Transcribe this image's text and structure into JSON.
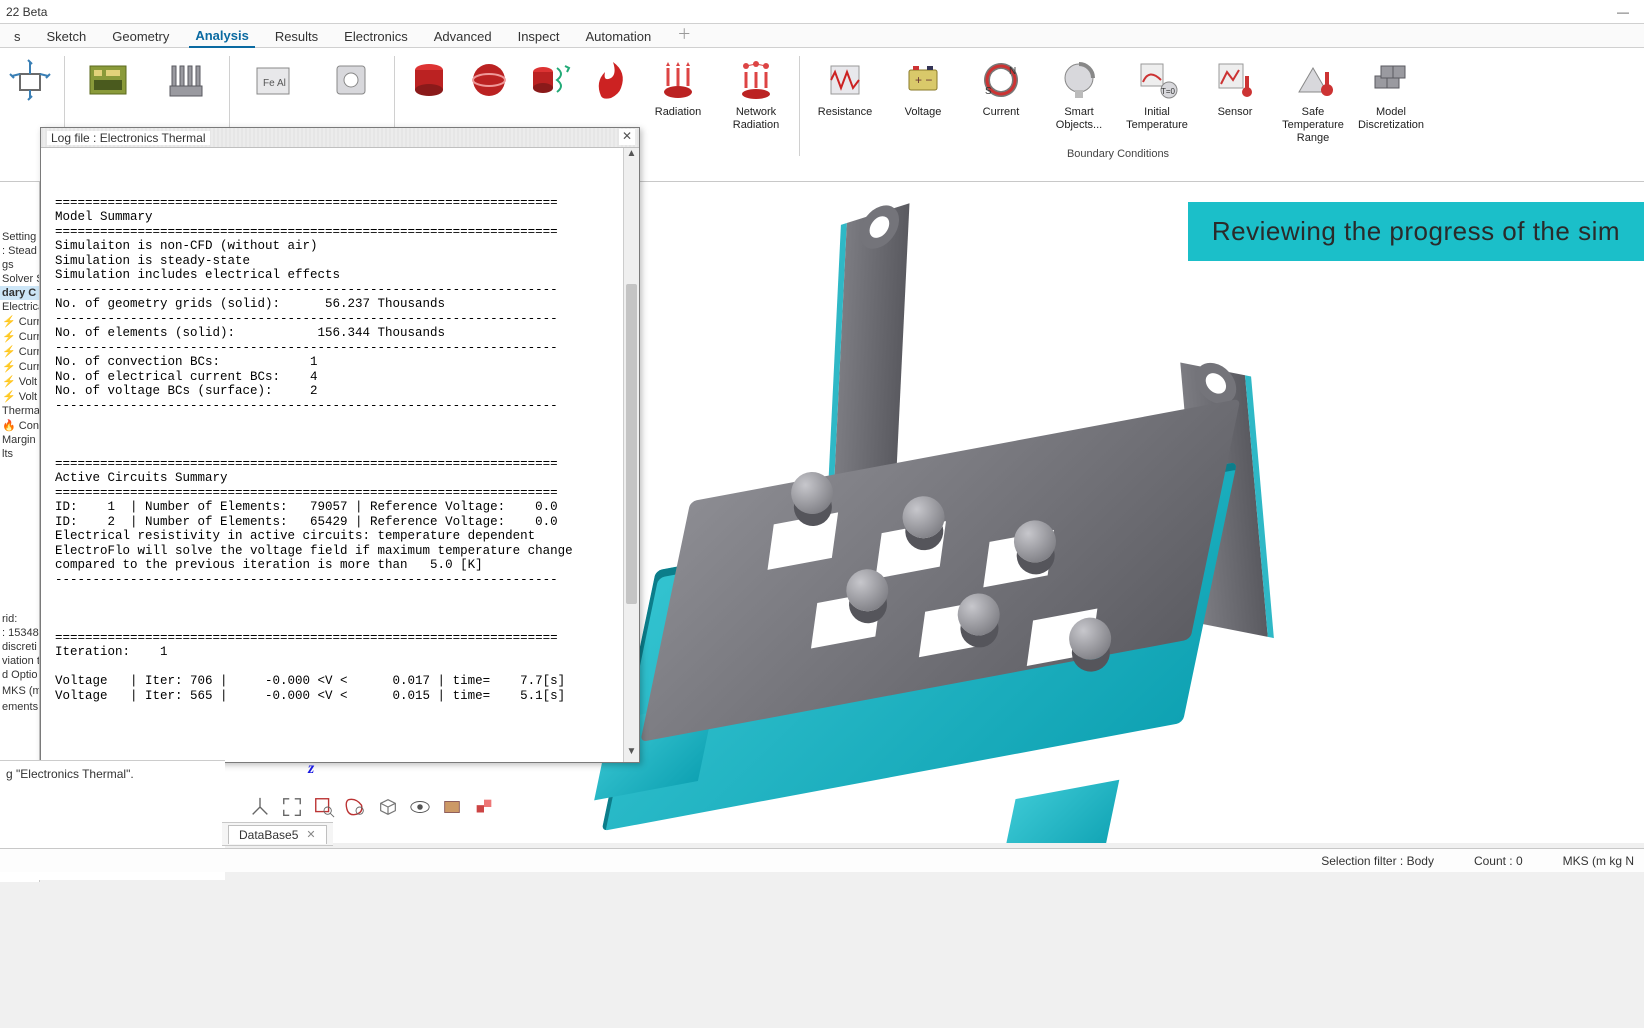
{
  "window": {
    "title": "22 Beta"
  },
  "menu": {
    "tabs": [
      "s",
      "Sketch",
      "Geometry",
      "Analysis",
      "Results",
      "Electronics",
      "Advanced",
      "Inspect",
      "Automation"
    ],
    "active_index": 3
  },
  "ribbon": {
    "group_label": "Boundary Conditions",
    "items_left": [
      {
        "label": ""
      },
      {
        "label": ""
      },
      {
        "label": ""
      },
      {
        "label": ""
      },
      {
        "label": ""
      },
      {
        "label": ""
      },
      {
        "label": ""
      },
      {
        "label": "Radiation"
      },
      {
        "label": "Network Radiation"
      }
    ],
    "items_right": [
      {
        "label": "Resistance"
      },
      {
        "label": "Voltage"
      },
      {
        "label": "Current"
      },
      {
        "label": "Smart Objects..."
      },
      {
        "label": "Initial Temperature"
      },
      {
        "label": "Sensor"
      },
      {
        "label": "Safe Temperature Range"
      },
      {
        "label": "Model Discretization"
      }
    ]
  },
  "tree": {
    "rows": [
      " Setting",
      ": Stead",
      "gs",
      "Solver S",
      "dary C",
      "Electrica",
      "⚡ Curr",
      "⚡ Curr",
      "⚡ Curr",
      "⚡ Curr",
      "⚡ Volt",
      "⚡ Volt",
      "Therma",
      "🔥 Con",
      "Margin",
      "lts"
    ],
    "selected_index": 4
  },
  "leftinfo": {
    "rows": [
      "rid:",
      ": 15348",
      "discreti",
      "viation t",
      "d Optio",
      "",
      "MKS (m",
      "",
      "ements"
    ]
  },
  "message": {
    "line": "g \"Electronics Thermal\"."
  },
  "log": {
    "title": "Log file : Electronics Thermal",
    "text": "\n\n\n===================================================================\nModel Summary\n===================================================================\nSimulaiton is non-CFD (without air)\nSimulation is steady-state\nSimulation includes electrical effects\n-------------------------------------------------------------------\nNo. of geometry grids (solid):      56.237 Thousands\n-------------------------------------------------------------------\nNo. of elements (solid):           156.344 Thousands\n-------------------------------------------------------------------\nNo. of convection BCs:            1\nNo. of electrical current BCs:    4\nNo. of voltage BCs (surface):     2\n-------------------------------------------------------------------\n\n\n\n===================================================================\nActive Circuits Summary\n===================================================================\nID:    1  | Number of Elements:   79057 | Reference Voltage:    0.0\nID:    2  | Number of Elements:   65429 | Reference Voltage:    0.0\nElectrical resistivity in active circuits: temperature dependent\nElectroFlo will solve the voltage field if maximum temperature change\ncompared to the previous iteration is more than   5.0 [K]\n-------------------------------------------------------------------\n\n\n\n===================================================================\nIteration:    1\n\nVoltage   | Iter: 706 |     -0.000 <V <      0.017 | time=    7.7[s]\nVoltage   | Iter: 565 |     -0.000 <V <      0.015 | time=    5.1[s]"
  },
  "banner": {
    "text": "Reviewing the progress of the sim"
  },
  "axis": {
    "z": "z"
  },
  "dbtab": {
    "label": "DataBase5"
  },
  "status": {
    "filter": "Selection filter : Body",
    "count": "Count : 0",
    "units": "MKS (m kg N"
  }
}
